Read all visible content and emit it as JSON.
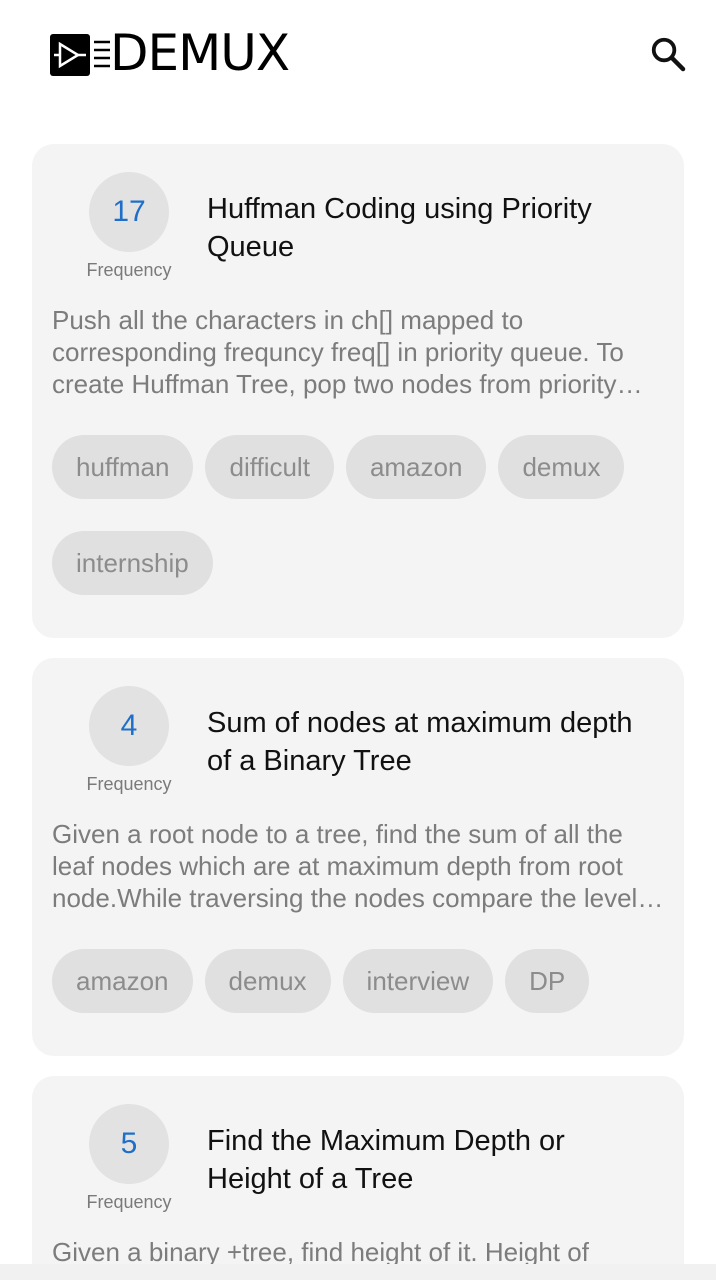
{
  "header": {
    "logo_text": "DEMUX",
    "search_icon": "search-icon"
  },
  "posts": [
    {
      "frequency": "17",
      "frequency_label": "Frequency",
      "title": "Huffman Coding using Priority Queue",
      "description": "Push all the characters in ch[] mapped to corresponding frequncy freq[] in priority queue. To create Huffman Tree, pop two nodes from priority queue.",
      "tags": [
        "huffman",
        "difficult",
        "amazon",
        "demux",
        "internship"
      ]
    },
    {
      "frequency": "4",
      "frequency_label": "Frequency",
      "title": "Sum of nodes at maximum depth of a Binary Tree",
      "description": "Given a root node to a tree, find the sum of all the leaf nodes which are at maximum depth from root node.While traversing the nodes compare the level of the node.",
      "tags": [
        "amazon",
        "demux",
        "interview",
        "DP"
      ]
    },
    {
      "frequency": "5",
      "frequency_label": "Frequency",
      "title": "Find the Maximum Depth or Height of a Tree",
      "description": "Given a binary +tree, find height of it. Height of",
      "tags": []
    }
  ],
  "colors": {
    "accent": "#1f6fc9",
    "card_bg": "#f4f4f4",
    "tag_bg": "#e0e0e0"
  }
}
